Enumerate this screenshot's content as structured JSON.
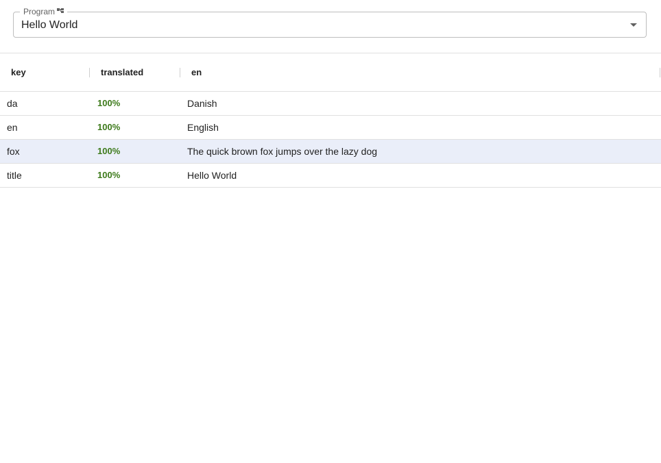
{
  "program_select": {
    "label": "Program",
    "value": "Hello World",
    "label_icon": "hierarchy-icon",
    "arrow_icon": "dropdown-arrow-icon"
  },
  "grid": {
    "columns": {
      "key": "key",
      "translated": "translated",
      "en": "en"
    },
    "rows": [
      {
        "key": "da",
        "translated": "100%",
        "en": "Danish"
      },
      {
        "key": "en",
        "translated": "100%",
        "en": "English"
      },
      {
        "key": "fox",
        "translated": "100%",
        "en": "The quick brown fox jumps over the lazy dog"
      },
      {
        "key": "title",
        "translated": "100%",
        "en": "Hello World"
      }
    ]
  },
  "colors": {
    "translated_text": "#3d7a1b",
    "selected_row": "#eaeef9",
    "border": "#e0e0e0"
  }
}
